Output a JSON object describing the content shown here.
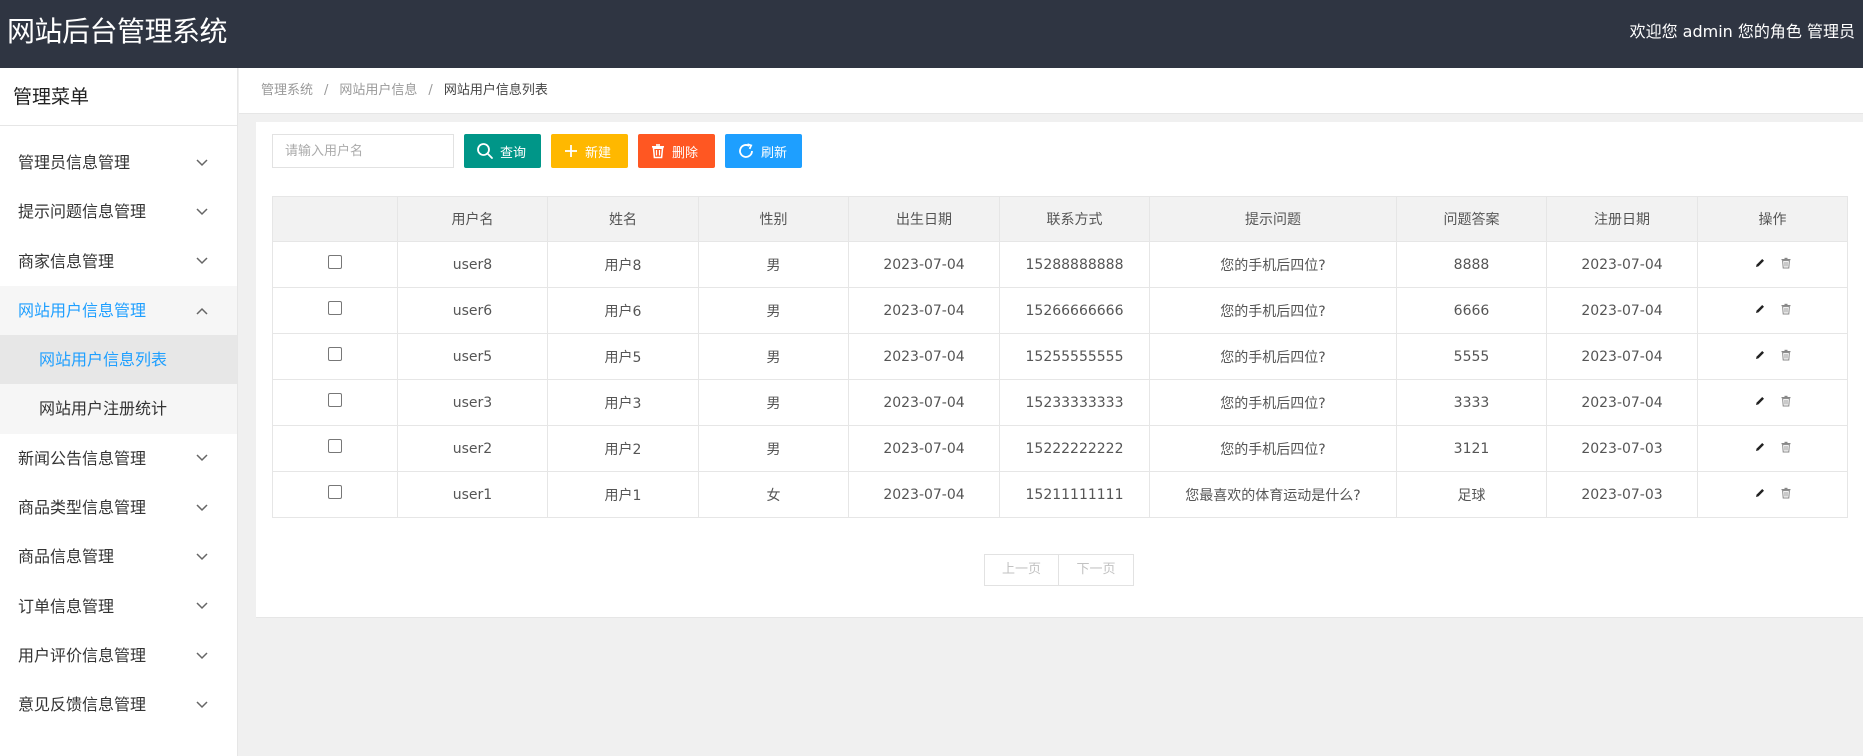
{
  "header": {
    "title": "网站后台管理系统",
    "welcome": "欢迎您 admin 您的角色 管理员"
  },
  "sidebar": {
    "title": "管理菜单",
    "items": [
      {
        "label": "管理员信息管理",
        "icon": "chevron-down-icon"
      },
      {
        "label": "提示问题信息管理",
        "icon": "chevron-down-icon"
      },
      {
        "label": "商家信息管理",
        "icon": "chevron-down-icon"
      },
      {
        "label": "网站用户信息管理",
        "icon": "chevron-up-icon",
        "open": true,
        "children": [
          {
            "label": "网站用户信息列表",
            "active": true
          },
          {
            "label": "网站用户注册统计"
          }
        ]
      },
      {
        "label": "新闻公告信息管理",
        "icon": "chevron-down-icon"
      },
      {
        "label": "商品类型信息管理",
        "icon": "chevron-down-icon"
      },
      {
        "label": "商品信息管理",
        "icon": "chevron-down-icon"
      },
      {
        "label": "订单信息管理",
        "icon": "chevron-down-icon"
      },
      {
        "label": "用户评价信息管理",
        "icon": "chevron-down-icon"
      },
      {
        "label": "意见反馈信息管理",
        "icon": "chevron-down-icon"
      }
    ]
  },
  "breadcrumb": {
    "items": [
      "管理系统",
      "网站用户信息",
      "网站用户信息列表"
    ],
    "separator": "/"
  },
  "toolbar": {
    "search_placeholder": "请输入用户名",
    "query_label": "查询",
    "new_label": "新建",
    "delete_label": "删除",
    "refresh_label": "刷新"
  },
  "table": {
    "columns": [
      "",
      "用户名",
      "姓名",
      "性别",
      "出生日期",
      "联系方式",
      "提示问题",
      "问题答案",
      "注册日期",
      "操作"
    ],
    "rows": [
      [
        "user8",
        "用户8",
        "男",
        "2023-07-04",
        "15288888888",
        "您的手机后四位?",
        "8888",
        "2023-07-04"
      ],
      [
        "user6",
        "用户6",
        "男",
        "2023-07-04",
        "15266666666",
        "您的手机后四位?",
        "6666",
        "2023-07-04"
      ],
      [
        "user5",
        "用户5",
        "男",
        "2023-07-04",
        "15255555555",
        "您的手机后四位?",
        "5555",
        "2023-07-04"
      ],
      [
        "user3",
        "用户3",
        "男",
        "2023-07-04",
        "15233333333",
        "您的手机后四位?",
        "3333",
        "2023-07-04"
      ],
      [
        "user2",
        "用户2",
        "男",
        "2023-07-04",
        "15222222222",
        "您的手机后四位?",
        "3121",
        "2023-07-03"
      ],
      [
        "user1",
        "用户1",
        "女",
        "2023-07-04",
        "15211111111",
        "您最喜欢的体育运动是什么?",
        "足球",
        "2023-07-03"
      ]
    ]
  },
  "pager": {
    "prev_label": "上一页",
    "next_label": "下一页"
  },
  "colors": {
    "header_bg": "#2f3542",
    "query": "#009688",
    "new": "#ffb800",
    "delete": "#ff5722",
    "refresh": "#1e9fff",
    "active_text": "#1e9fff"
  }
}
